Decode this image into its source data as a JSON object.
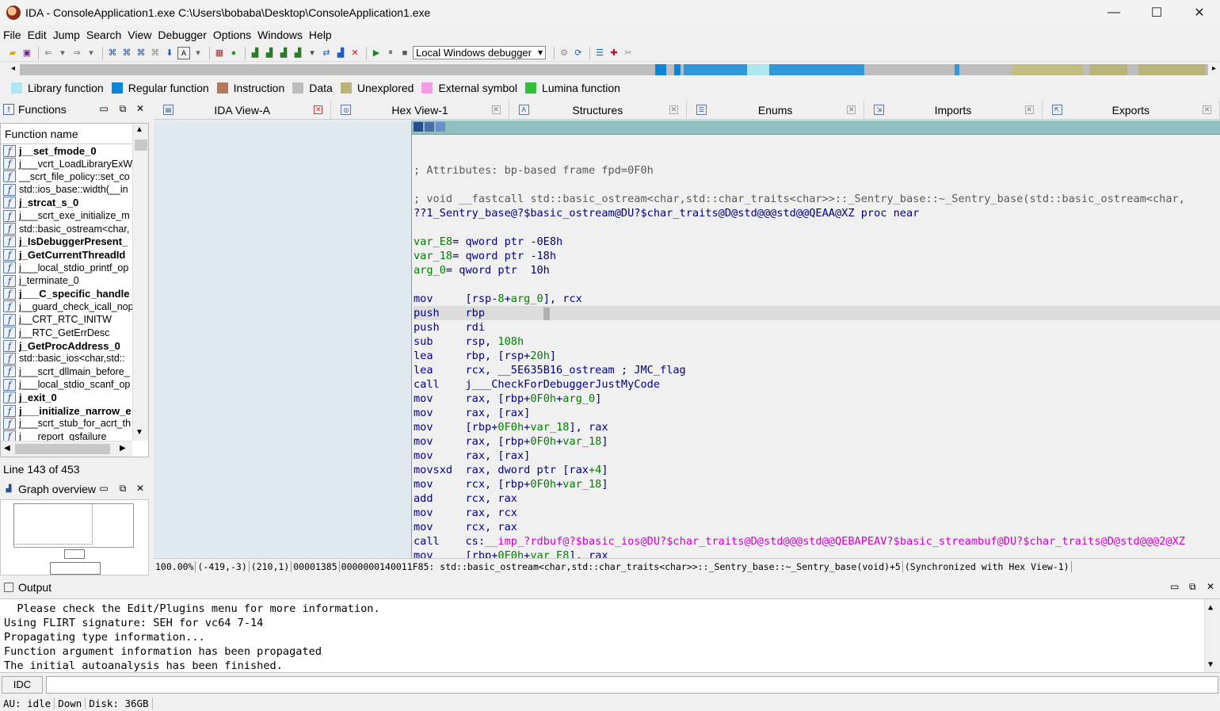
{
  "window": {
    "title": "IDA - ConsoleApplication1.exe C:\\Users\\bobaba\\Desktop\\ConsoleApplication1.exe",
    "minimize": "—",
    "maximize": "☐",
    "close": "✕"
  },
  "menu": [
    "File",
    "Edit",
    "Jump",
    "Search",
    "View",
    "Debugger",
    "Options",
    "Windows",
    "Help"
  ],
  "toolbar": {
    "debugger_select": "Local Windows debugger"
  },
  "legend": [
    {
      "label": "Library function",
      "color": "#aee7f0"
    },
    {
      "label": "Regular function",
      "color": "#0a84d6"
    },
    {
      "label": "Instruction",
      "color": "#b27a5f"
    },
    {
      "label": "Data",
      "color": "#bdbdbd"
    },
    {
      "label": "Unexplored",
      "color": "#b8b47a"
    },
    {
      "label": "External symbol",
      "color": "#f59ce8"
    },
    {
      "label": "Lumina function",
      "color": "#2fbf3a"
    }
  ],
  "tabs": [
    {
      "label": "IDA View-A",
      "icon": "ida-view-icon",
      "active": true
    },
    {
      "label": "Hex View-1",
      "icon": "hex-view-icon",
      "active": false
    },
    {
      "label": "Structures",
      "icon": "structures-icon",
      "active": false
    },
    {
      "label": "Enums",
      "icon": "enums-icon",
      "active": false
    },
    {
      "label": "Imports",
      "icon": "imports-icon",
      "active": false
    },
    {
      "label": "Exports",
      "icon": "exports-icon",
      "active": false
    }
  ],
  "functions_panel": {
    "title": "Functions",
    "column_header": "Function name",
    "items": [
      {
        "name": "j__set_fmode_0",
        "bold": true
      },
      {
        "name": "j___vcrt_LoadLibraryExW",
        "bold": false
      },
      {
        "name": "__scrt_file_policy::set_co",
        "bold": false
      },
      {
        "name": "std::ios_base::width(__in",
        "bold": false
      },
      {
        "name": "j_strcat_s_0",
        "bold": true
      },
      {
        "name": "j___scrt_exe_initialize_m",
        "bold": false
      },
      {
        "name": "std::basic_ostream<char,",
        "bold": false
      },
      {
        "name": "j_IsDebuggerPresent_",
        "bold": true
      },
      {
        "name": "j_GetCurrentThreadId",
        "bold": true
      },
      {
        "name": "j___local_stdio_printf_op",
        "bold": false
      },
      {
        "name": "j_terminate_0",
        "bold": false
      },
      {
        "name": "j___C_specific_handle",
        "bold": true
      },
      {
        "name": "j__guard_check_icall_nop",
        "bold": false
      },
      {
        "name": "j__CRT_RTC_INITW",
        "bold": false
      },
      {
        "name": "j__RTC_GetErrDesc",
        "bold": false
      },
      {
        "name": "j_GetProcAddress_0",
        "bold": true
      },
      {
        "name": "std::basic_ios<char,std::",
        "bold": false
      },
      {
        "name": "j___scrt_dllmain_before_",
        "bold": false
      },
      {
        "name": "j___local_stdio_scanf_op",
        "bold": false
      },
      {
        "name": "j_exit_0",
        "bold": true
      },
      {
        "name": "j___initialize_narrow_e",
        "bold": true
      },
      {
        "name": "j___scrt_stub_for_acrt_th",
        "bold": false
      },
      {
        "name": "j___report_gsfailure",
        "bold": false
      }
    ],
    "line_info": "Line 143 of 453"
  },
  "graph_overview": {
    "title": "Graph overview"
  },
  "disasm": {
    "lines": [
      {
        "type": "comment",
        "text": "; Attributes: bp-based frame fpd=0F0h"
      },
      {
        "type": "blank"
      },
      {
        "type": "comment",
        "text": "; void __fastcall std::basic_ostream<char,std::char_traits<char>>::_Sentry_base::~_Sentry_base(std::basic_ostream<char,"
      },
      {
        "type": "proc",
        "text": "??1_Sentry_base@?$basic_ostream@DU?$char_traits@D@std@@@std@@QEAA@XZ proc near"
      },
      {
        "type": "blank"
      },
      {
        "type": "vardef",
        "name": "var_E8",
        "rest": "= qword ptr -0E8h"
      },
      {
        "type": "vardef",
        "name": "var_18",
        "rest": "= qword ptr -18h"
      },
      {
        "type": "vardef",
        "name": "arg_0",
        "rest": "= qword ptr  10h"
      },
      {
        "type": "blank"
      },
      {
        "type": "ins",
        "mn": "mov",
        "op": "[rsp-8+arg_0], rcx"
      },
      {
        "type": "ins",
        "mn": "push",
        "op": "rbp",
        "hl": true
      },
      {
        "type": "ins",
        "mn": "push",
        "op": "rdi"
      },
      {
        "type": "ins",
        "mn": "sub",
        "op": "rsp, 108h"
      },
      {
        "type": "ins",
        "mn": "lea",
        "op": "rbp, [rsp+20h]"
      },
      {
        "type": "ins",
        "mn": "lea",
        "op": "rcx, __5E635B16_ostream ; JMC_flag"
      },
      {
        "type": "ins",
        "mn": "call",
        "op": "j___CheckForDebuggerJustMyCode"
      },
      {
        "type": "ins",
        "mn": "mov",
        "op": "rax, [rbp+0F0h+arg_0]"
      },
      {
        "type": "ins",
        "mn": "mov",
        "op": "rax, [rax]"
      },
      {
        "type": "ins",
        "mn": "mov",
        "op": "[rbp+0F0h+var_18], rax"
      },
      {
        "type": "ins",
        "mn": "mov",
        "op": "rax, [rbp+0F0h+var_18]"
      },
      {
        "type": "ins",
        "mn": "mov",
        "op": "rax, [rax]"
      },
      {
        "type": "ins",
        "mn": "movsxd",
        "op": "rax, dword ptr [rax+4]"
      },
      {
        "type": "ins",
        "mn": "mov",
        "op": "rcx, [rbp+0F0h+var_18]"
      },
      {
        "type": "ins",
        "mn": "add",
        "op": "rcx, rax"
      },
      {
        "type": "ins",
        "mn": "mov",
        "op": "rax, rcx"
      },
      {
        "type": "ins",
        "mn": "mov",
        "op": "rcx, rax"
      },
      {
        "type": "ins",
        "mn": "call",
        "op": "cs:__imp_?rdbuf@?$basic_ios@DU?$char_traits@D@std@@@std@@QEBAPEAV?$basic_streambuf@DU?$char_traits@D@std@@@2@XZ",
        "imp": true
      },
      {
        "type": "ins",
        "mn": "mov",
        "op": "[rbp+0F0h+var_E8], rax"
      }
    ]
  },
  "status": {
    "zoom": "100.00%",
    "coords1": "(-419,-3)",
    "coords2": "(210,1)",
    "offset": "00001385",
    "address": "0000000140011F85: std::basic_ostream<char,std::char_traits<char>>::_Sentry_base::~_Sentry_base(void)+5",
    "sync": "(Synchronized with Hex View-1)"
  },
  "output": {
    "title": "Output",
    "lines": [
      "  Please check the Edit/Plugins menu for more information.",
      "Using FLIRT signature: SEH for vc64 7-14",
      "Propagating type information...",
      "Function argument information has been propagated",
      "The initial autoanalysis has been finished."
    ],
    "idc_button": "IDC"
  },
  "bottom_status": {
    "au": "AU:  idle",
    "dir": "Down",
    "disk": "Disk: 36GB"
  }
}
